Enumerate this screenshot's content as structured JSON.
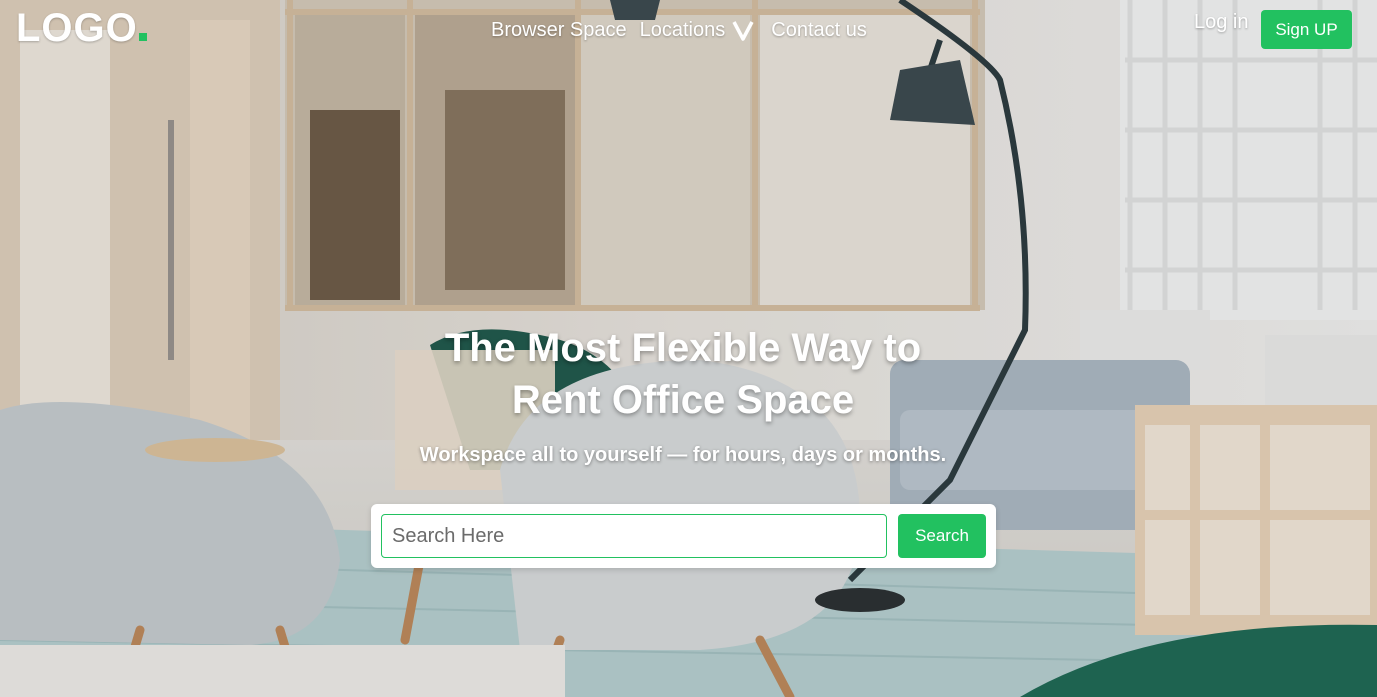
{
  "brand": {
    "logo_text": "LOGO",
    "accent_color": "#22c160"
  },
  "nav": {
    "items": [
      {
        "label": "Browser Space"
      },
      {
        "label": "Locations",
        "icon": "chevron-down-icon"
      },
      {
        "label": "Contact us"
      }
    ],
    "login_label": "Log in",
    "signup_label": "Sign UP"
  },
  "hero": {
    "headline_line1": "The Most Flexible Way to",
    "headline_line2": "Rent Office Space",
    "subheadline": "Workspace all to yourself — for hours, days or months."
  },
  "search": {
    "placeholder": "Search Here",
    "value": "",
    "button_label": "Search"
  }
}
